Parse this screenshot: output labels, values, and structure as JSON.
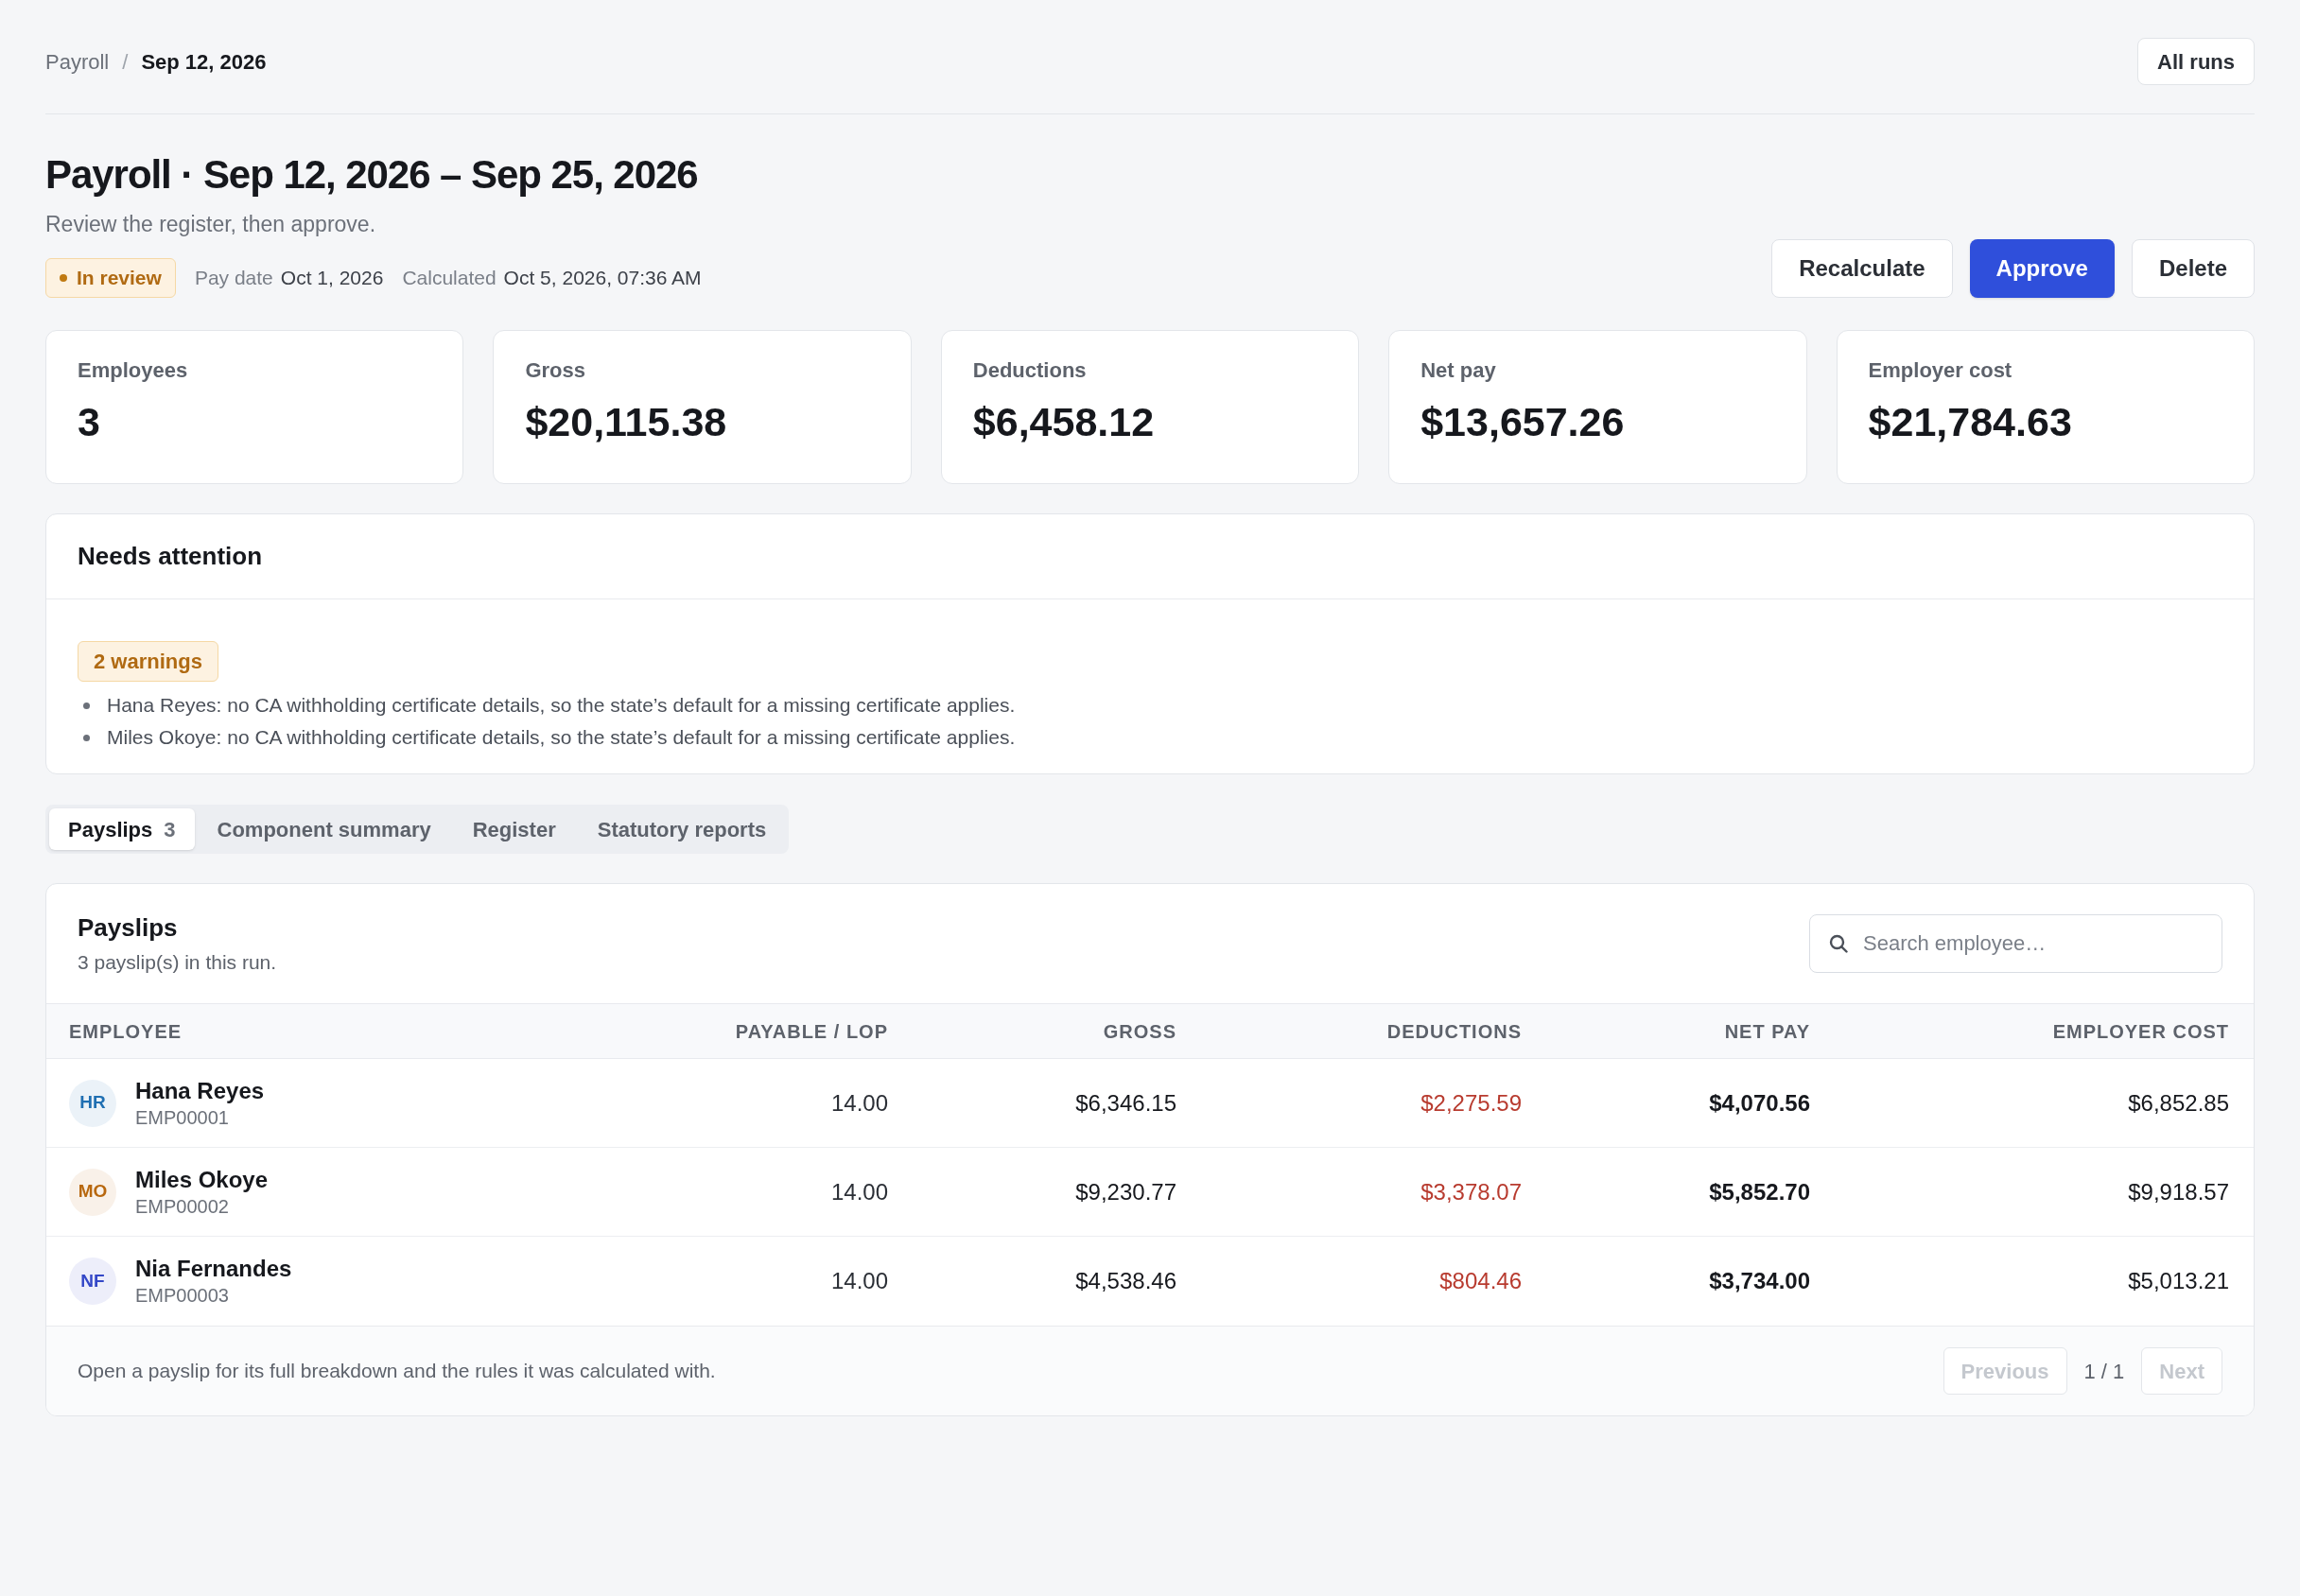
{
  "breadcrumb": {
    "parent": "Payroll",
    "separator": "/",
    "current": "Sep 12, 2026"
  },
  "all_runs_button": "All runs",
  "header": {
    "title": "Payroll · Sep 12, 2026 – Sep 25, 2026",
    "subtitle": "Review the register, then approve.",
    "status": "In review",
    "meta": [
      {
        "label": "Pay date",
        "value": "Oct 1, 2026"
      },
      {
        "label": "Calculated",
        "value": "Oct 5, 2026, 07:36 AM"
      }
    ],
    "actions": [
      {
        "label": "Recalculate",
        "kind": "secondary"
      },
      {
        "label": "Approve",
        "kind": "primary"
      },
      {
        "label": "Delete",
        "kind": "secondary"
      }
    ]
  },
  "stats": [
    {
      "label": "Employees",
      "value": "3"
    },
    {
      "label": "Gross",
      "value": "$20,115.38"
    },
    {
      "label": "Deductions",
      "value": "$6,458.12"
    },
    {
      "label": "Net pay",
      "value": "$13,657.26"
    },
    {
      "label": "Employer cost",
      "value": "$21,784.63"
    }
  ],
  "attention": {
    "title": "Needs attention",
    "badge": "2 warnings",
    "items": [
      "Hana Reyes: no CA withholding certificate details, so the state’s default for a missing certificate applies.",
      "Miles Okoye: no CA withholding certificate details, so the state’s default for a missing certificate applies."
    ]
  },
  "tabs": [
    {
      "label": "Payslips",
      "count": "3",
      "selected": true
    },
    {
      "label": "Component summary",
      "selected": false
    },
    {
      "label": "Register",
      "selected": false
    },
    {
      "label": "Statutory reports",
      "selected": false
    }
  ],
  "payslips": {
    "title": "Payslips",
    "subtitle": "3 payslip(s) in this run.",
    "search": {
      "placeholder": "Search employee…"
    },
    "columns": [
      "EMPLOYEE",
      "PAYABLE / LOP",
      "GROSS",
      "DEDUCTIONS",
      "NET PAY",
      "EMPLOYER COST"
    ],
    "rows": [
      {
        "initials": "HR",
        "color": "#1f6fb2",
        "name": "Hana Reyes",
        "employee_id": "EMP00001",
        "payable_lop": "14.00",
        "gross": "$6,346.15",
        "deductions": "$2,275.59",
        "net_pay": "$4,070.56",
        "employer_cost": "$6,852.85"
      },
      {
        "initials": "MO",
        "color": "#b8680f",
        "name": "Miles Okoye",
        "employee_id": "EMP00002",
        "payable_lop": "14.00",
        "gross": "$9,230.77",
        "deductions": "$3,378.07",
        "net_pay": "$5,852.70",
        "employer_cost": "$9,918.57"
      },
      {
        "initials": "NF",
        "color": "#3347c7",
        "name": "Nia Fernandes",
        "employee_id": "EMP00003",
        "payable_lop": "14.00",
        "gross": "$4,538.46",
        "deductions": "$804.46",
        "net_pay": "$3,734.00",
        "employer_cost": "$5,013.21"
      }
    ],
    "footer_note": "Open a payslip for its full breakdown and the rules it was calculated with.",
    "pagination": {
      "previous": {
        "label": "Previous",
        "disabled": true
      },
      "page": "1 / 1",
      "next": {
        "label": "Next",
        "disabled": true
      }
    }
  }
}
